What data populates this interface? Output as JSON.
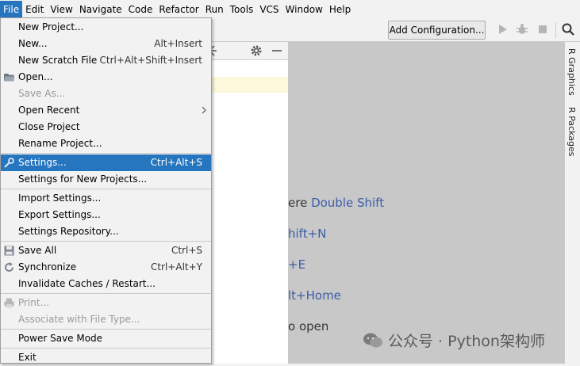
{
  "menubar": [
    "File",
    "Edit",
    "View",
    "Navigate",
    "Code",
    "Refactor",
    "Run",
    "Tools",
    "VCS",
    "Window",
    "Help"
  ],
  "toolbar": {
    "config_label": "Add Configuration..."
  },
  "file_menu": {
    "new_project": "New Project...",
    "new": "New...",
    "new_sc": "Alt+Insert",
    "new_scratch": "New Scratch File",
    "new_scratch_sc": "Ctrl+Alt+Shift+Insert",
    "open": "Open...",
    "save_as": "Save As...",
    "open_recent": "Open Recent",
    "close_project": "Close Project",
    "rename_project": "Rename Project...",
    "settings": "Settings...",
    "settings_sc": "Ctrl+Alt+S",
    "settings_new": "Settings for New Projects...",
    "import_settings": "Import Settings...",
    "export_settings": "Export Settings...",
    "settings_repo": "Settings Repository...",
    "save_all": "Save All",
    "save_all_sc": "Ctrl+S",
    "synchronize": "Synchronize",
    "synchronize_sc": "Ctrl+Alt+Y",
    "invalidate": "Invalidate Caches / Restart...",
    "print": "Print...",
    "associate": "Associate with File Type...",
    "power_save": "Power Save Mode",
    "exit": "Exit"
  },
  "editor_hints": {
    "h1_pre": "ere ",
    "h1_key": "Double Shift",
    "h2_key": "hift+N",
    "h3_key": "+E",
    "h4_key": "lt+Home",
    "h5_pre": "o open"
  },
  "right_tabs": [
    "R Graphics",
    "R Packages"
  ],
  "watermark": "公众号 · Python架构师",
  "colors": {
    "selection": "#2675bf",
    "editor_bg": "#c8c8c8",
    "hint_key": "#3a5ea8"
  }
}
